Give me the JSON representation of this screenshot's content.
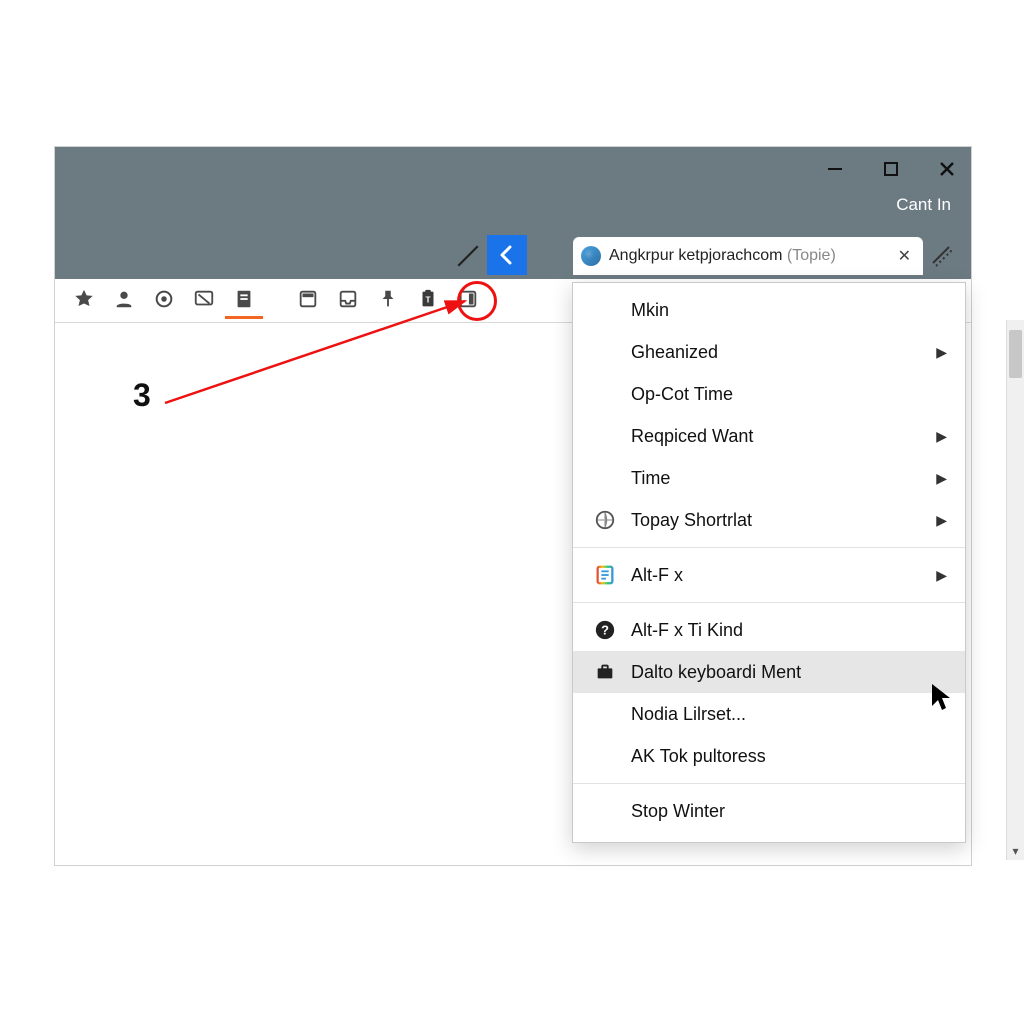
{
  "window": {
    "signin_label": "Cant In"
  },
  "tab": {
    "title_main": "Angkrpur ketpjorachcom",
    "title_suffix": "(Topie)"
  },
  "annotation": {
    "step_number": "3"
  },
  "toolbar": {
    "icons": [
      "favorites-star-icon",
      "profile-icon",
      "refresh-icon",
      "mail-compose-icon",
      "notes-icon",
      "panel-top-icon",
      "inbox-icon",
      "pin-icon",
      "clipboard-icon",
      "panel-right-icon"
    ],
    "active_index": 4,
    "circled_index": 8
  },
  "menu": {
    "items": [
      {
        "label": "Mkin",
        "icon": null,
        "submenu": false
      },
      {
        "label": "Gheanized",
        "icon": null,
        "submenu": true
      },
      {
        "label": "Op-Cot Time",
        "icon": null,
        "submenu": false
      },
      {
        "label": "Reqpiced Want",
        "icon": null,
        "submenu": true
      },
      {
        "label": "Time",
        "icon": null,
        "submenu": true
      },
      {
        "label": "Topay Shortrlat",
        "icon": "globe",
        "submenu": true
      },
      {
        "type": "separator"
      },
      {
        "label": "Alt-F x",
        "icon": "multicolor",
        "submenu": true
      },
      {
        "type": "separator"
      },
      {
        "label": "Alt-F x Ti Kind",
        "icon": "question",
        "submenu": false
      },
      {
        "label": "Dalto keyboardi Ment",
        "icon": "case",
        "submenu": false,
        "hover": true
      },
      {
        "label": "Nodia Lilrset...",
        "icon": null,
        "submenu": false
      },
      {
        "label": "AK Tok pultoress",
        "icon": null,
        "submenu": false
      },
      {
        "type": "separator"
      },
      {
        "label": "Stop Winter",
        "icon": null,
        "submenu": false
      }
    ]
  }
}
